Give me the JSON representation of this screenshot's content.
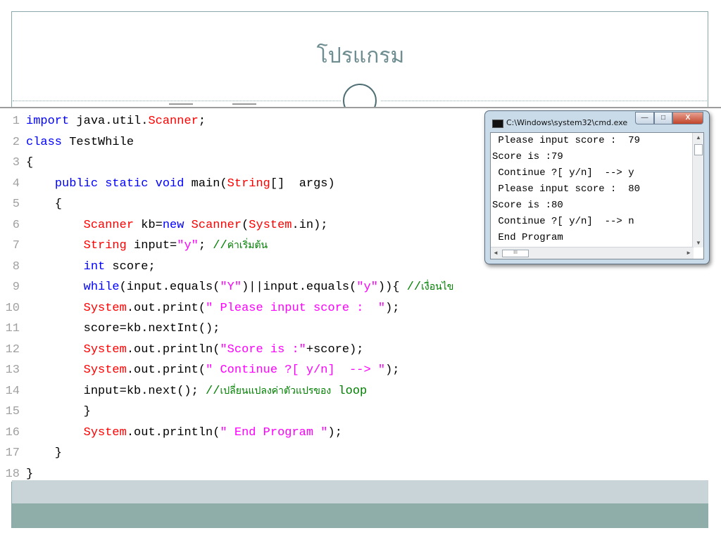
{
  "slide": {
    "title": "โปรแกรม"
  },
  "code": {
    "lines": [
      {
        "no": "1",
        "parts": [
          [
            "kw",
            "import"
          ],
          [
            "pl",
            " java.util."
          ],
          [
            "cls",
            "Scanner"
          ],
          [
            "pl",
            ";"
          ]
        ]
      },
      {
        "no": "2",
        "parts": [
          [
            "kw",
            "class"
          ],
          [
            "pl",
            " TestWhile"
          ]
        ]
      },
      {
        "no": "3",
        "parts": [
          [
            "pl",
            "{"
          ]
        ]
      },
      {
        "no": "4",
        "parts": [
          [
            "pl",
            "    "
          ],
          [
            "kw",
            "public static void"
          ],
          [
            "pl",
            " main("
          ],
          [
            "cls",
            "String"
          ],
          [
            "pl",
            "[]  args)"
          ]
        ]
      },
      {
        "no": "5",
        "parts": [
          [
            "pl",
            "    {"
          ]
        ]
      },
      {
        "no": "6",
        "parts": [
          [
            "pl",
            "        "
          ],
          [
            "cls",
            "Scanner"
          ],
          [
            "pl",
            " kb="
          ],
          [
            "kw",
            "new"
          ],
          [
            "pl",
            " "
          ],
          [
            "cls",
            "Scanner"
          ],
          [
            "pl",
            "("
          ],
          [
            "cls",
            "System"
          ],
          [
            "pl",
            ".in);"
          ]
        ]
      },
      {
        "no": "7",
        "parts": [
          [
            "pl",
            "        "
          ],
          [
            "cls",
            "String"
          ],
          [
            "pl",
            " input="
          ],
          [
            "str",
            "\"y\""
          ],
          [
            "pl",
            "; "
          ],
          [
            "cm",
            "//"
          ],
          [
            "cmth",
            "ค่าเริ่มต้น"
          ]
        ]
      },
      {
        "no": "8",
        "parts": [
          [
            "pl",
            "        "
          ],
          [
            "kw",
            "int"
          ],
          [
            "pl",
            " score;"
          ]
        ]
      },
      {
        "no": "9",
        "parts": [
          [
            "pl",
            "        "
          ],
          [
            "kw",
            "while"
          ],
          [
            "pl",
            "(input.equals("
          ],
          [
            "str",
            "\"Y\""
          ],
          [
            "pl",
            ")||input.equals("
          ],
          [
            "str",
            "\"y\""
          ],
          [
            "pl",
            ")){ "
          ],
          [
            "cm",
            "//"
          ],
          [
            "cmth",
            "เงื่อนไข"
          ]
        ]
      },
      {
        "no": "10",
        "parts": [
          [
            "pl",
            "        "
          ],
          [
            "cls",
            "System"
          ],
          [
            "pl",
            ".out.print("
          ],
          [
            "str",
            "\" Please input score :  \""
          ],
          [
            "pl",
            ");"
          ]
        ]
      },
      {
        "no": "11",
        "parts": [
          [
            "pl",
            "        score=kb.nextInt();"
          ]
        ]
      },
      {
        "no": "12",
        "parts": [
          [
            "pl",
            "        "
          ],
          [
            "cls",
            "System"
          ],
          [
            "pl",
            ".out.println("
          ],
          [
            "str",
            "\"Score is :\""
          ],
          [
            "pl",
            "+score);"
          ]
        ]
      },
      {
        "no": "13",
        "parts": [
          [
            "pl",
            "        "
          ],
          [
            "cls",
            "System"
          ],
          [
            "pl",
            ".out.print("
          ],
          [
            "str",
            "\" Continue ?[ y/n]  --> \""
          ],
          [
            "pl",
            ");"
          ]
        ]
      },
      {
        "no": "14",
        "parts": [
          [
            "pl",
            "        input=kb.next(); "
          ],
          [
            "cm",
            "//"
          ],
          [
            "cmth",
            "เปลี่ยนแปลงค่าตัวแปรของ"
          ],
          [
            "cm",
            " loop"
          ]
        ]
      },
      {
        "no": "15",
        "parts": [
          [
            "pl",
            "        }"
          ]
        ]
      },
      {
        "no": "16",
        "parts": [
          [
            "pl",
            "        "
          ],
          [
            "cls",
            "System"
          ],
          [
            "pl",
            ".out.println("
          ],
          [
            "str",
            "\" End Program \""
          ],
          [
            "pl",
            ");"
          ]
        ]
      },
      {
        "no": "17",
        "parts": [
          [
            "pl",
            "    }"
          ]
        ]
      },
      {
        "no": "18",
        "parts": [
          [
            "pl",
            "}"
          ]
        ]
      }
    ]
  },
  "cmd": {
    "title": "C:\\Windows\\system32\\cmd.exe",
    "minimize": "—",
    "maximize": "□",
    "close": "X",
    "output": [
      " Please input score :  79",
      "Score is :79",
      " Continue ?[ y/n]  --> y",
      " Please input score :  80",
      "Score is :80",
      " Continue ?[ y/n]  --> n",
      " End Program"
    ],
    "hthumb": "III",
    "arrow_up": "▲",
    "arrow_down": "▼",
    "arrow_left": "◄",
    "arrow_right": "►"
  }
}
